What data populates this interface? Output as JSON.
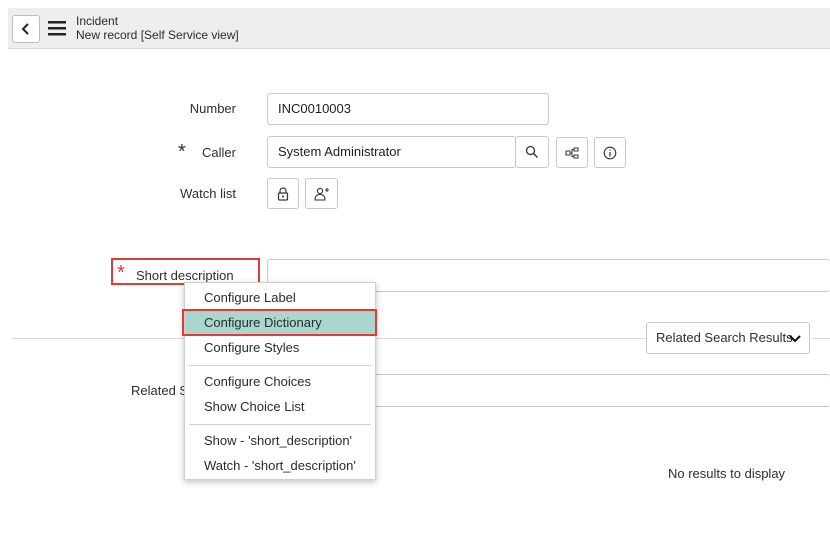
{
  "header": {
    "title": "Incident",
    "subtitle": "New record [Self Service view]"
  },
  "form": {
    "number_label": "Number",
    "number_value": "INC0010003",
    "caller_label": "Caller",
    "caller_value": "System Administrator",
    "watch_list_label": "Watch list",
    "short_description_label": "Short description",
    "short_description_value": "",
    "related_search_label": "Related S",
    "required_mark": "*"
  },
  "related": {
    "dropdown_label": "Related Search Results",
    "empty_text": "No results to display"
  },
  "context_menu": {
    "items": [
      "Configure Label",
      "Configure Dictionary",
      "Configure Styles",
      "Configure Choices",
      "Show Choice List",
      "Show - 'short_description'",
      "Watch - 'short_description'"
    ],
    "selected_index": 1
  },
  "colors": {
    "required": "#e53935",
    "menu_selected": "#a9d7cf",
    "header_bg": "#eeeeee"
  },
  "icons": [
    "back-icon",
    "menu-icon",
    "search-icon",
    "hierarchy-icon",
    "info-icon",
    "lock-icon",
    "add-user-icon",
    "chevron-down-icon"
  ]
}
